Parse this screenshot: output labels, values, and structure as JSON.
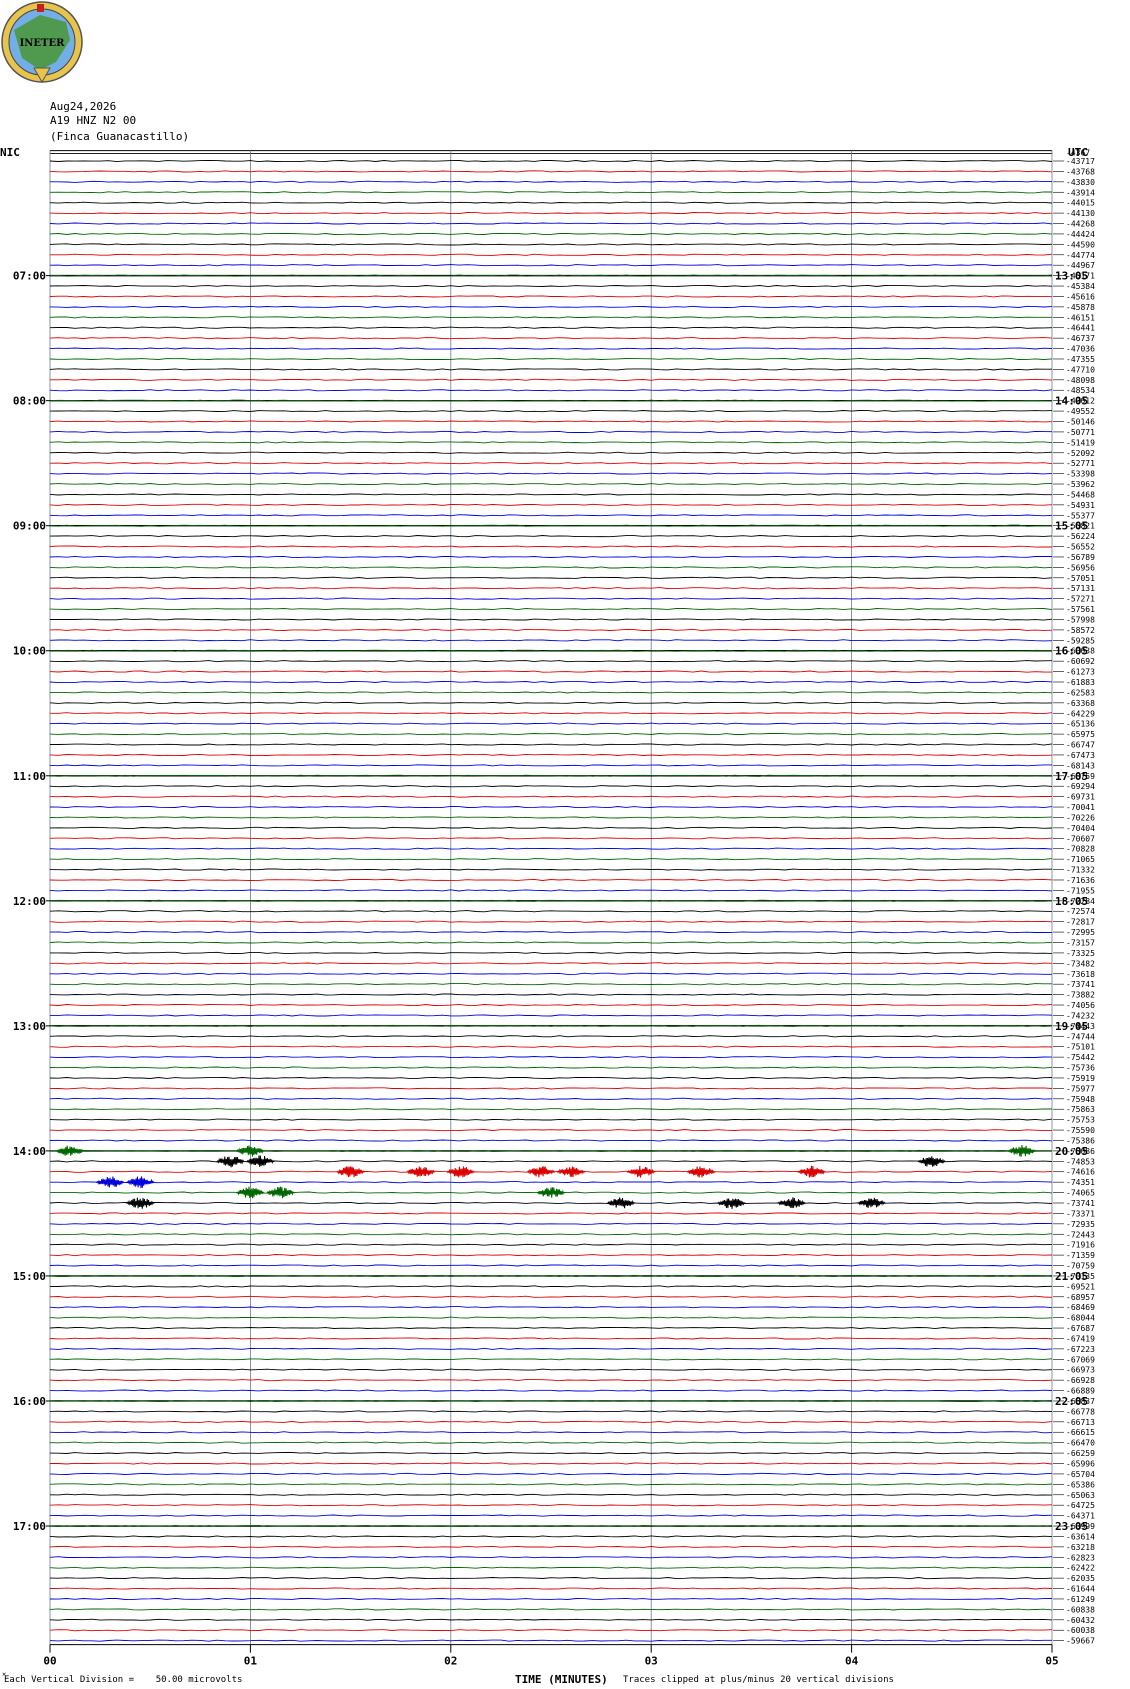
{
  "header": {
    "date": "Aug24,2026",
    "station": "A19 HNZ N2 00",
    "site": "(Finca Guanacastillo)",
    "logo_text": "INETER"
  },
  "timezones": {
    "left": "NIC",
    "right": "UTC"
  },
  "footer": {
    "division": "Each Vertical Division =    50.00 microvolts",
    "xlabel": "TIME (MINUTES)",
    "clip": "Traces clipped at plus/minus 20 vertical divisions"
  },
  "chart_data": {
    "type": "line",
    "description_kind": "helicorder",
    "trace_colors": [
      "#000000",
      "#dd0000",
      "#0000dd",
      "#006600"
    ],
    "xlabel": "TIME (MINUTES)",
    "xlim": [
      0,
      5
    ],
    "x_ticks": [
      "00",
      "01",
      "02",
      "03",
      "04",
      "05"
    ],
    "left_hour_labels": [
      "07:00",
      "08:00",
      "09:00",
      "10:00",
      "11:00",
      "12:00",
      "13:00",
      "14:00",
      "15:00",
      "16:00",
      "17:00"
    ],
    "right_hour_labels": [
      "13:05",
      "14:05",
      "15:05",
      "16:05",
      "17:05",
      "18:05",
      "19:05",
      "20:05",
      "21:05",
      "22:05",
      "23:05"
    ],
    "first_hour_row": 12,
    "rows_per_hour": 12,
    "row_offsets": [
      -43717,
      -43768,
      -43830,
      -43914,
      -44015,
      -44130,
      -44268,
      -44424,
      -44590,
      -44774,
      -44967,
      -45171,
      -45384,
      -45616,
      -45878,
      -46151,
      -46441,
      -46737,
      -47036,
      -47355,
      -47710,
      -48098,
      -48534,
      -49012,
      -49552,
      -50146,
      -50771,
      -51419,
      -52092,
      -52771,
      -53398,
      -53962,
      -54468,
      -54931,
      -55377,
      -55821,
      -56224,
      -56552,
      -56789,
      -56956,
      -57051,
      -57131,
      -57271,
      -57561,
      -57998,
      -58572,
      -59285,
      -60038,
      -60692,
      -61273,
      -61883,
      -62583,
      -63368,
      -64229,
      -65136,
      -65975,
      -66747,
      -67473,
      -68143,
      -68759,
      -69294,
      -69731,
      -70041,
      -70226,
      -70404,
      -70607,
      -70828,
      -71065,
      -71332,
      -71636,
      -71955,
      -72284,
      -72574,
      -72817,
      -72995,
      -73157,
      -73325,
      -73482,
      -73618,
      -73741,
      -73882,
      -74056,
      -74232,
      -74443,
      -74744,
      -75101,
      -75442,
      -75736,
      -75919,
      -75977,
      -75948,
      -75863,
      -75753,
      -75590,
      -75386,
      -75086,
      -74853,
      -74616,
      -74351,
      -74065,
      -73741,
      -73371,
      -72935,
      -72443,
      -71916,
      -71359,
      -70759,
      -70135,
      -69521,
      -68957,
      -68469,
      -68044,
      -67687,
      -67419,
      -67223,
      -67069,
      -66973,
      -66928,
      -66889,
      -66837,
      -66778,
      -66713,
      -66615,
      -66470,
      -66259,
      -65996,
      -65704,
      -65386,
      -65063,
      -64725,
      -64371,
      -63999,
      -63614,
      -63218,
      -62823,
      -62422,
      -62035,
      -61644,
      -61249,
      -60838,
      -60432,
      -60038,
      -59667
    ],
    "top_offset_partial": "-4367",
    "events": [
      {
        "row": 95,
        "minutes": [
          0.1,
          1.0,
          4.85
        ],
        "color_index": 3
      },
      {
        "row": 96,
        "minutes": [
          0.9,
          1.05,
          4.4
        ],
        "color_index": 0
      },
      {
        "row": 97,
        "minutes": [
          1.5,
          1.85,
          2.05,
          2.45,
          2.6,
          2.95,
          3.25,
          3.8
        ],
        "color_index": 1
      },
      {
        "row": 98,
        "minutes": [
          0.3,
          0.45
        ],
        "color_index": 2
      },
      {
        "row": 99,
        "minutes": [
          1.0,
          1.15,
          2.5
        ],
        "color_index": 3
      },
      {
        "row": 100,
        "minutes": [
          0.45,
          2.85,
          3.4,
          3.7,
          4.1
        ],
        "color_index": 0
      }
    ]
  }
}
